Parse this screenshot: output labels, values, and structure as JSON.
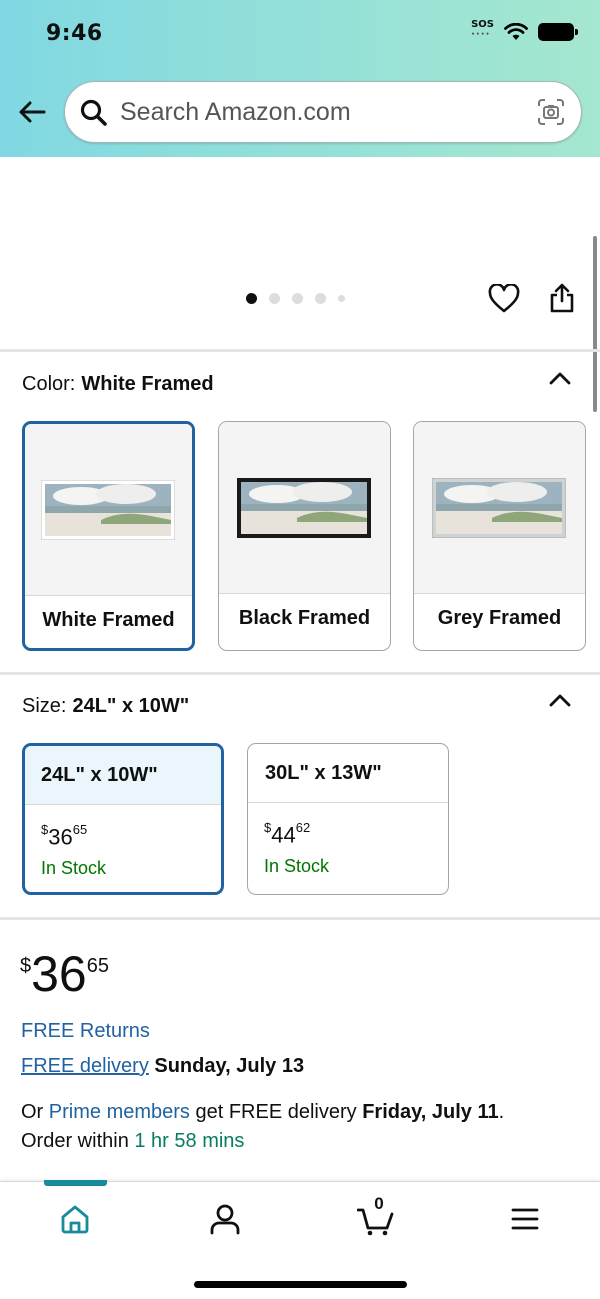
{
  "status_bar": {
    "time": "9:46",
    "sos": "SOS"
  },
  "search": {
    "placeholder": "Search Amazon.com"
  },
  "gallery": {
    "dot_count": 5,
    "active_dot": 1
  },
  "color": {
    "label": "Color:",
    "selected": "White Framed",
    "options": [
      {
        "label": "White Framed",
        "frame_color": "#ffffff"
      },
      {
        "label": "Black Framed",
        "frame_color": "#1a1a1a"
      },
      {
        "label": "Grey Framed",
        "frame_color": "#cfd2d3"
      }
    ]
  },
  "size": {
    "label": "Size:",
    "selected": "24L\" x 10W\"",
    "options": [
      {
        "label": "24L\" x 10W\"",
        "price_symbol": "$",
        "price_whole": "36",
        "price_fraction": "65",
        "stock": "In Stock"
      },
      {
        "label": "30L\" x 13W\"",
        "price_symbol": "$",
        "price_whole": "44",
        "price_fraction": "62",
        "stock": "In Stock"
      }
    ]
  },
  "price": {
    "symbol": "$",
    "whole": "36",
    "fraction": "65"
  },
  "delivery": {
    "returns": "FREE Returns",
    "free_delivery_link": "FREE delivery",
    "free_delivery_date": "Sunday, July 13",
    "prime_prefix": "Or",
    "prime_link": "Prime members",
    "prime_mid": "get FREE delivery",
    "prime_date": "Friday, July 11",
    "prime_suffix": ".",
    "order_within_prefix": "Order within",
    "order_within_time": "1 hr 58 mins"
  },
  "bottom_nav": {
    "cart_count": "0"
  },
  "colors": {
    "accent": "#2162a1",
    "teal": "#178a9b",
    "stock_green": "#007600"
  }
}
